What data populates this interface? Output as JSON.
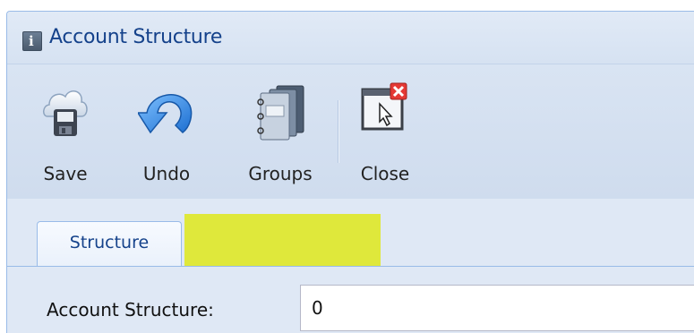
{
  "window": {
    "title": "Account Structure"
  },
  "toolbar": {
    "save_label": "Save",
    "undo_label": "Undo",
    "groups_label": "Groups",
    "close_label": "Close"
  },
  "tabs": [
    {
      "label": "Structure",
      "active": true
    }
  ],
  "form": {
    "account_structure_label": "Account Structure:",
    "account_structure_value": "0"
  },
  "colors": {
    "title_text": "#15428b",
    "highlight": "#dfe83b",
    "panel_background": "#dfe8f5",
    "border": "#99bbe8"
  },
  "icons": {
    "title": "info-icon",
    "save": "cloud-save-icon",
    "undo": "undo-arrow-icon",
    "groups": "notebooks-icon",
    "close": "close-window-icon"
  }
}
